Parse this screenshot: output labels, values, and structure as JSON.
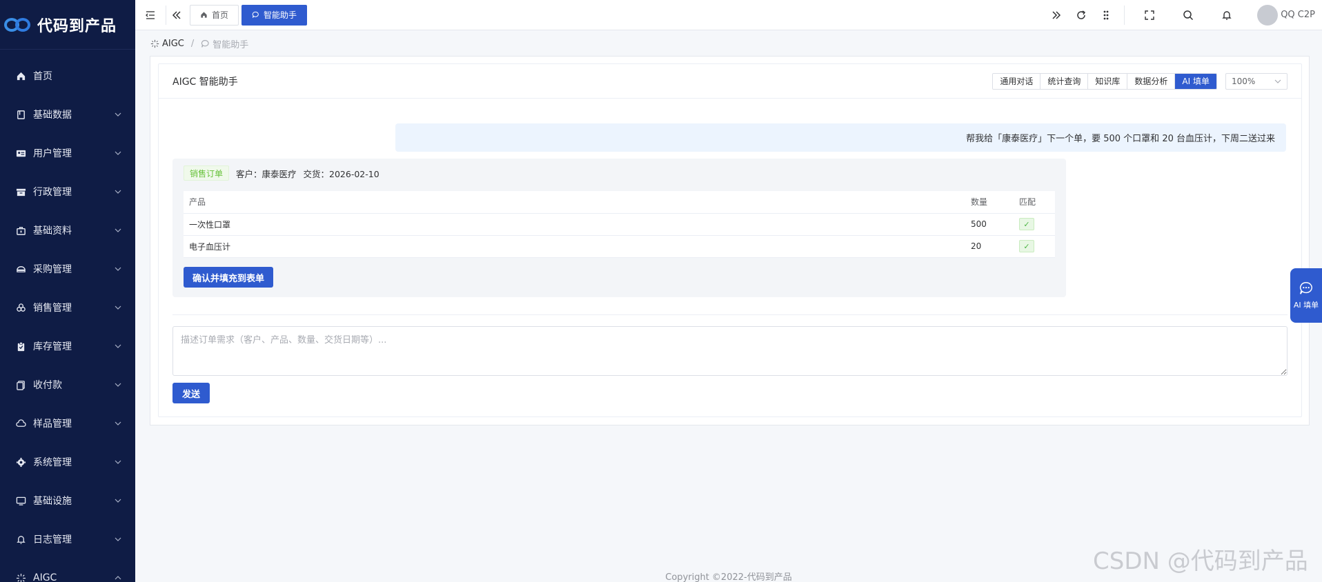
{
  "brand": {
    "name": "代码到产品"
  },
  "sidebar": {
    "items": [
      {
        "label": "首页",
        "icon": "home-icon",
        "expandable": false
      },
      {
        "label": "基础数据",
        "icon": "database-icon",
        "expandable": true
      },
      {
        "label": "用户管理",
        "icon": "id-card-icon",
        "expandable": true
      },
      {
        "label": "行政管理",
        "icon": "archive-icon",
        "expandable": true
      },
      {
        "label": "基础资料",
        "icon": "briefcase-icon",
        "expandable": true
      },
      {
        "label": "采购管理",
        "icon": "cart-icon",
        "expandable": true
      },
      {
        "label": "销售管理",
        "icon": "coins-icon",
        "expandable": true
      },
      {
        "label": "库存管理",
        "icon": "clipboard-icon",
        "expandable": true
      },
      {
        "label": "收付款",
        "icon": "wallet-icon",
        "expandable": true
      },
      {
        "label": "样品管理",
        "icon": "cloud-icon",
        "expandable": true
      },
      {
        "label": "系统管理",
        "icon": "gear-icon",
        "expandable": true
      },
      {
        "label": "基础设施",
        "icon": "monitor-icon",
        "expandable": true
      },
      {
        "label": "日志管理",
        "icon": "bell-icon",
        "expandable": true
      },
      {
        "label": "AIGC",
        "icon": "sparkle-icon",
        "expandable": true,
        "expanded": true
      }
    ]
  },
  "topbar": {
    "tabs": [
      {
        "label": "首页",
        "icon": "home-icon",
        "active": false
      },
      {
        "label": "智能助手",
        "icon": "chat-icon",
        "active": true
      }
    ],
    "user": {
      "name": "QQ C2P"
    }
  },
  "breadcrumb": {
    "root": "AIGC",
    "current": "智能助手"
  },
  "card": {
    "title": "AIGC 智能助手",
    "modes": [
      {
        "label": "通用对话",
        "active": false
      },
      {
        "label": "统计查询",
        "active": false
      },
      {
        "label": "知识库",
        "active": false
      },
      {
        "label": "数据分析",
        "active": false
      },
      {
        "label": "AI 填单",
        "active": true
      }
    ],
    "zoom": "100%"
  },
  "chat": {
    "user_message": "帮我给「康泰医疗」下一个单，要 500 个口罩和 20 台血压计，下周二送过来",
    "order_tag": "销售订单",
    "customer": "客户：康泰医疗",
    "delivery": "交货：2026-02-10",
    "table": {
      "headers": [
        "产品",
        "数量",
        "匹配"
      ],
      "rows": [
        {
          "product": "一次性口罩",
          "qty": "500",
          "match": "✓"
        },
        {
          "product": "电子血压计",
          "qty": "20",
          "match": "✓"
        }
      ]
    },
    "confirm_label": "确认并填充到表单"
  },
  "composer": {
    "placeholder": "描述订单需求（客户、产品、数量、交货日期等）...",
    "send_label": "发送"
  },
  "float_button": {
    "label": "AI 填单"
  },
  "footer": {
    "copyright": "Copyright ©2022-代码到产品"
  },
  "watermark": "CSDN @代码到产品",
  "colors": {
    "sidebar_bg": "#0f1c45",
    "primary": "#2f5bcf",
    "success": "#67c23a"
  }
}
